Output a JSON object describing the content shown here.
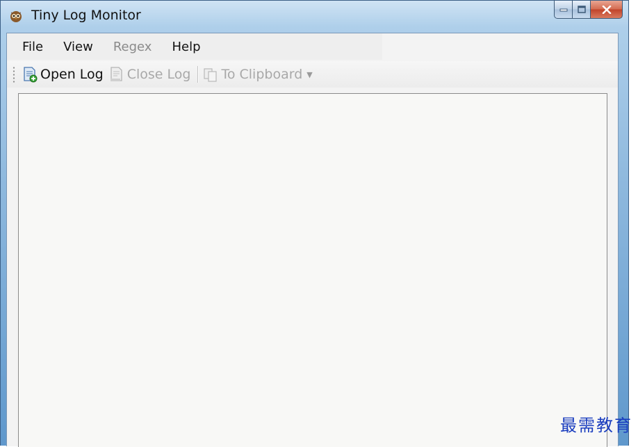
{
  "window": {
    "title": "Tiny Log Monitor",
    "icon": "owl-app-icon",
    "controls": {
      "minimize": "minimize-icon",
      "maximize": "maximize-icon",
      "close": "close-icon"
    }
  },
  "menu": {
    "items": [
      {
        "label": "File",
        "enabled": true
      },
      {
        "label": "View",
        "enabled": true
      },
      {
        "label": "Regex",
        "enabled": false
      },
      {
        "label": "Help",
        "enabled": true
      }
    ]
  },
  "toolbar": {
    "open_log": {
      "label": "Open Log",
      "icon": "open-log-icon",
      "enabled": true
    },
    "close_log": {
      "label": "Close Log",
      "icon": "close-log-icon",
      "enabled": false
    },
    "to_clipboard": {
      "label": "To Clipboard",
      "icon": "clipboard-icon",
      "enabled": false
    }
  },
  "watermark": "最需教育",
  "colors": {
    "title_bar": "#aecfea",
    "client_bg": "#f3f3f3",
    "disabled_text": "#a8a8a8",
    "watermark": "#1a3dbf"
  }
}
